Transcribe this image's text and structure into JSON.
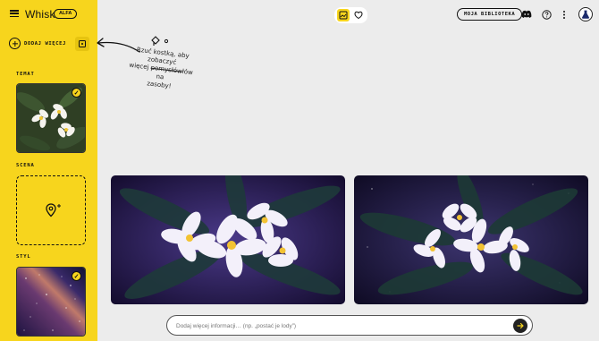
{
  "app": {
    "title": "Whisk",
    "badge": "ALFA"
  },
  "sidebar": {
    "add_more_label": "DODAJ WIĘCEJ",
    "sections": {
      "subject": "TEMAT",
      "scene": "SCENA",
      "style": "STYL"
    }
  },
  "header": {
    "library_label": "MOJA BIBLIOTEKA"
  },
  "annotation": {
    "line1": "Rzuć kostką, aby",
    "line2": "zobaczyć",
    "line3_pre": "więcej ",
    "line3_strike": "pomysłów",
    "line3_post": "łów na",
    "line4": "zasoby!"
  },
  "prompt": {
    "placeholder": "Dodaj więcej informacji… (np. „postać je lody”)"
  },
  "colors": {
    "accent": "#f7d51d",
    "background": "#ececec"
  },
  "icons": {
    "menu": "hamburger-icon",
    "add": "plus-circle-icon",
    "dice": "dice-icon",
    "image_view": "image-view-icon",
    "favorites": "heart-icon",
    "discord": "discord-icon",
    "help": "help-icon",
    "more": "more-vert-icon",
    "send": "arrow-right-icon",
    "location": "location-pin-icon"
  }
}
